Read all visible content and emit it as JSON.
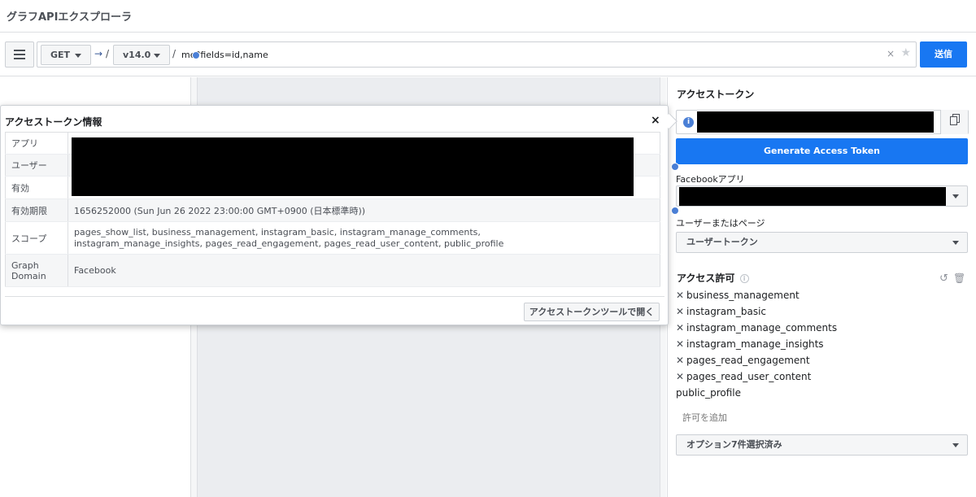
{
  "header": {
    "title": "グラフAPIエクスプローラ"
  },
  "toolbar": {
    "method": "GET",
    "arrow": "→",
    "slash": "/",
    "version": "v14.0",
    "path_value": "me?fields=id,name",
    "submit_label": "送信",
    "clear": "×",
    "star": "★"
  },
  "right_panel": {
    "token_title": "アクセストークン",
    "generate_label": "Generate Access Token",
    "fb_app_label": "Facebookアプリ",
    "user_or_page_label": "ユーザーまたはページ",
    "user_or_page_value": "ユーザートークン",
    "permissions_title": "アクセス許可",
    "permissions": [
      {
        "name": "business_management",
        "removable": true
      },
      {
        "name": "instagram_basic",
        "removable": true
      },
      {
        "name": "instagram_manage_comments",
        "removable": true
      },
      {
        "name": "instagram_manage_insights",
        "removable": true
      },
      {
        "name": "pages_read_engagement",
        "removable": true
      },
      {
        "name": "pages_read_user_content",
        "removable": true
      },
      {
        "name": "public_profile",
        "removable": false
      }
    ],
    "add_permission_placeholder": "許可を追加",
    "options_value": "オプション7件選択済み"
  },
  "popup": {
    "title": "アクセストークン情報",
    "close": "×",
    "rows": [
      {
        "key": "アプリ",
        "value": ""
      },
      {
        "key": "ユーザー",
        "value": ""
      },
      {
        "key": "有効",
        "value": ""
      },
      {
        "key": "有効期限",
        "value": "1656252000 (Sun Jun 26 2022 23:00:00 GMT+0900 (日本標準時))"
      },
      {
        "key": "スコープ",
        "value": "pages_show_list, business_management, instagram_basic, instagram_manage_comments, instagram_manage_insights, pages_read_engagement, pages_read_user_content, public_profile"
      },
      {
        "key": "Graph Domain",
        "value": "Facebook"
      }
    ],
    "open_tool_label": "アクセストークンツールで開く"
  },
  "colors": {
    "accent": "#1877f2",
    "cursor": "#4a7fd6"
  }
}
